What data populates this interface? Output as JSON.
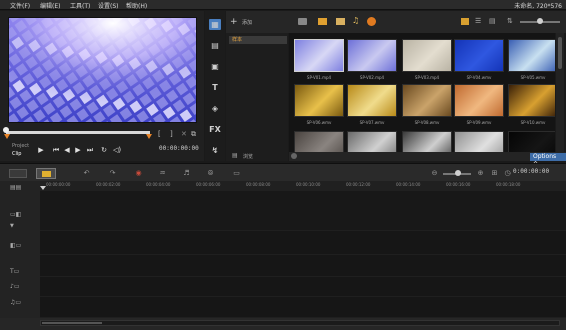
{
  "menu": {
    "items": [
      "文件(F)",
      "编辑(E)",
      "工具(T)",
      "设置(S)",
      "帮助(H)"
    ],
    "project_info": "未命名, 720*576"
  },
  "player": {
    "mode_project": "Project",
    "mode_clip": "Clip",
    "timecode": "00:00:00:00",
    "controls": [
      "play-icon",
      "previous-icon",
      "rewind-icon",
      "forward-icon",
      "next-icon",
      "loop-icon",
      "volume-icon"
    ]
  },
  "library": {
    "add_label": "添加",
    "folder_name": "样本",
    "bottom_label": "浏览",
    "options_label": "Options",
    "thumbnails": [
      {
        "label": "SP-V01.mp4",
        "color1": "#7d7fe0",
        "color2": "#d8d8f5",
        "selected": true
      },
      {
        "label": "SP-V02.mp4",
        "color1": "#6d70d8",
        "color2": "#c9c9f0",
        "selected": false
      },
      {
        "label": "SP-V03.mp4",
        "color1": "#b9b3a4",
        "color2": "#e3ddcf",
        "selected": false
      },
      {
        "label": "SP-V04.wmv",
        "color1": "#1434b8",
        "color2": "#2f57e0",
        "selected": false
      },
      {
        "label": "SP-V05.wmv",
        "color1": "#3a5fb4",
        "color2": "#c8e0f0",
        "selected": false
      },
      {
        "label": "SP-V06.wmv",
        "color1": "#7a5a10",
        "color2": "#e8c04a",
        "selected": false
      },
      {
        "label": "SP-V07.wmv",
        "color1": "#b88a18",
        "color2": "#f0dc8c",
        "selected": false
      },
      {
        "label": "SP-V08.wmv",
        "color1": "#6a4a20",
        "color2": "#caa36a",
        "selected": false
      },
      {
        "label": "SP-V09.wmv",
        "color1": "#c06a30",
        "color2": "#f0b880",
        "selected": false
      },
      {
        "label": "SP-V10.wmv",
        "color1": "#3a2008",
        "color2": "#d8a030",
        "selected": false
      },
      {
        "label": "",
        "color1": "#4a4440",
        "color2": "#8a8480",
        "selected": false
      },
      {
        "label": "",
        "color1": "#6a6a6a",
        "color2": "#d0d0d0",
        "selected": false
      },
      {
        "label": "",
        "color1": "#3a3a3a",
        "color2": "#cfcfcf",
        "selected": false
      },
      {
        "label": "",
        "color1": "#909090",
        "color2": "#e0e0e0",
        "selected": false
      },
      {
        "label": "",
        "color1": "#050505",
        "color2": "#151515",
        "selected": false
      }
    ]
  },
  "timeline": {
    "timecode": "0:00:00:00",
    "ruler": [
      "00:00:00:00",
      "00:00:02:00",
      "00:00:04:00",
      "00:00:06:00",
      "00:00:08:00",
      "00:00:10:00",
      "00:00:12:00",
      "00:00:14:00",
      "00:00:16:00",
      "00:00:18:00"
    ]
  },
  "colors": {
    "accent": "#4a7fc0",
    "folder_text": "#e8a640",
    "options": "#3e6da8"
  }
}
